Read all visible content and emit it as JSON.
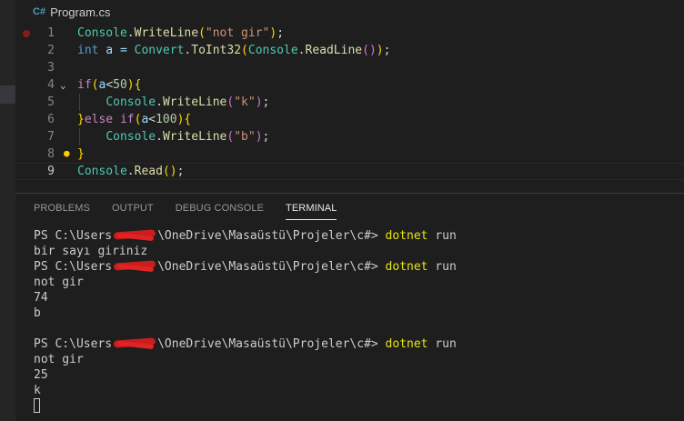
{
  "file": {
    "icon": "C#",
    "name": "Program.cs"
  },
  "editor": {
    "lines": [
      {
        "num": "1",
        "tokens": [
          [
            "Console",
            "cls"
          ],
          [
            ".",
            "p"
          ],
          [
            "WriteLine",
            "fn"
          ],
          [
            "(",
            "b1"
          ],
          [
            "\"not gir\"",
            "str"
          ],
          [
            ")",
            "b1"
          ],
          [
            ";",
            "p"
          ]
        ],
        "breakpoint": true
      },
      {
        "num": "2",
        "tokens": [
          [
            "int",
            "kw"
          ],
          [
            " a = ",
            "var"
          ],
          [
            "Convert",
            "cls"
          ],
          [
            ".",
            "p"
          ],
          [
            "ToInt32",
            "fn"
          ],
          [
            "(",
            "b1"
          ],
          [
            "Console",
            "cls"
          ],
          [
            ".",
            "p"
          ],
          [
            "ReadLine",
            "fn"
          ],
          [
            "()",
            "b2"
          ],
          [
            ")",
            "b1"
          ],
          [
            ";",
            "p"
          ]
        ]
      },
      {
        "num": "3",
        "tokens": []
      },
      {
        "num": "4",
        "tokens": [
          [
            "if",
            "ctl"
          ],
          [
            "(",
            "b1"
          ],
          [
            "a",
            "var"
          ],
          [
            "<",
            "p"
          ],
          [
            "50",
            "num"
          ],
          [
            ")",
            "b1"
          ],
          [
            "{",
            "b1"
          ]
        ],
        "fold": true
      },
      {
        "num": "5",
        "tokens": [
          [
            "    ",
            "p"
          ],
          [
            "Console",
            "cls"
          ],
          [
            ".",
            "p"
          ],
          [
            "WriteLine",
            "fn"
          ],
          [
            "(",
            "b2"
          ],
          [
            "\"k\"",
            "str"
          ],
          [
            ")",
            "b2"
          ],
          [
            ";",
            "p"
          ]
        ]
      },
      {
        "num": "6",
        "tokens": [
          [
            "}",
            "b1"
          ],
          [
            "else ",
            "ctl"
          ],
          [
            "if",
            "ctl"
          ],
          [
            "(",
            "b1"
          ],
          [
            "a",
            "var"
          ],
          [
            "<",
            "p"
          ],
          [
            "100",
            "num"
          ],
          [
            ")",
            "b1"
          ],
          [
            "{",
            "b1"
          ]
        ]
      },
      {
        "num": "7",
        "tokens": [
          [
            "    ",
            "p"
          ],
          [
            "Console",
            "cls"
          ],
          [
            ".",
            "p"
          ],
          [
            "WriteLine",
            "fn"
          ],
          [
            "(",
            "b2"
          ],
          [
            "\"b\"",
            "str"
          ],
          [
            ")",
            "b2"
          ],
          [
            ";",
            "p"
          ]
        ]
      },
      {
        "num": "8",
        "tokens": [
          [
            "}",
            "b1"
          ]
        ]
      },
      {
        "num": "9",
        "tokens": [
          [
            "Console",
            "cls"
          ],
          [
            ".",
            "p"
          ],
          [
            "Read",
            "fn"
          ],
          [
            "()",
            "b1"
          ],
          [
            ";",
            "p"
          ]
        ],
        "current": true
      }
    ]
  },
  "panel": {
    "tabs": [
      {
        "label": "PROBLEMS",
        "active": false
      },
      {
        "label": "OUTPUT",
        "active": false
      },
      {
        "label": "DEBUG CONSOLE",
        "active": false
      },
      {
        "label": "TERMINAL",
        "active": true
      }
    ]
  },
  "terminal": {
    "prompt_prefix": "PS C:\\Users",
    "prompt_suffix": "\\OneDrive\\Masaüstü\\Projeler\\c#> ",
    "command": "dotnet",
    "command_arg": " run",
    "blocks": [
      {
        "lines": [
          "bir sayı giriniz"
        ]
      },
      {
        "lines": [
          "not gir",
          "74",
          "b",
          ""
        ]
      },
      {
        "lines": [
          "not gir",
          "25",
          "k"
        ]
      }
    ]
  }
}
